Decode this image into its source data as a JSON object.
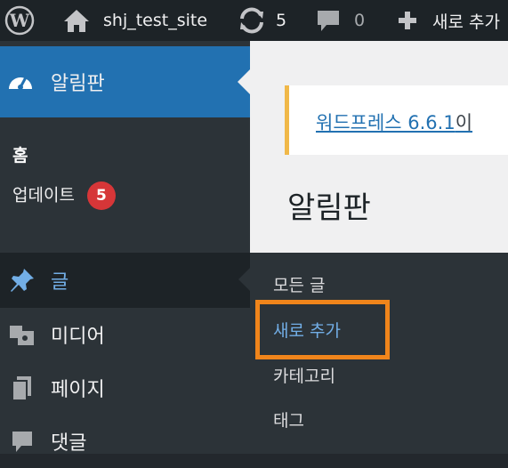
{
  "adminbar": {
    "site_name": "shj_test_site",
    "updates_count": "5",
    "comments_count": "0",
    "new_label": "새로 추가"
  },
  "sidebar": {
    "dashboard_label": "알림판",
    "home_label": "홈",
    "updates_label": "업데이트",
    "updates_badge": "5",
    "posts_label": "글",
    "media_label": "미디어",
    "pages_label": "페이지",
    "comments_label": "댓글"
  },
  "main": {
    "notice_link": "워드프레스 6.6.1",
    "notice_rest": "이",
    "page_title": "알림판"
  },
  "flyout": {
    "items": [
      "모든 글",
      "새로 추가",
      "카테고리",
      "태그"
    ]
  },
  "colors": {
    "adminbar_bg": "#1d2327",
    "sidebar_bg": "#2c3338",
    "active_menu": "#2271b1",
    "highlight": "#f0851b",
    "badge": "#d63638",
    "notice_border": "#f0b849"
  }
}
